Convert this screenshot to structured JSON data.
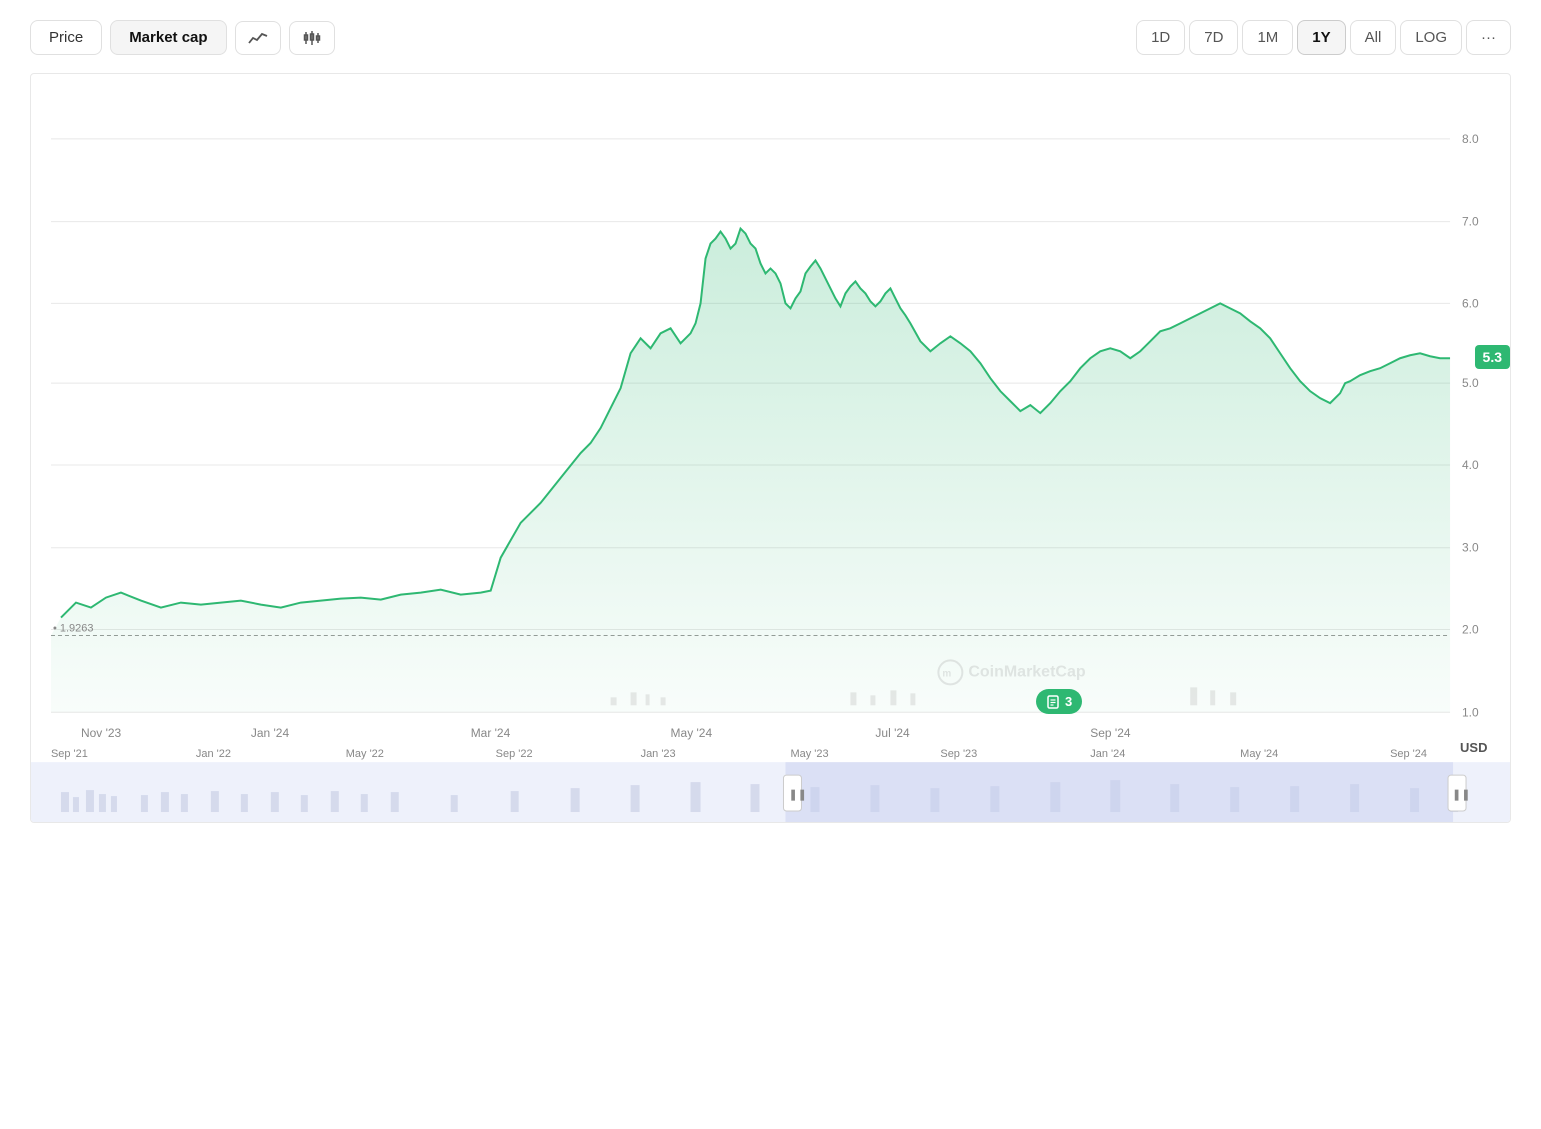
{
  "toolbar": {
    "left": {
      "price_label": "Price",
      "market_cap_label": "Market cap",
      "line_icon": "〜",
      "candle_icon": "⊞"
    },
    "right": {
      "time_buttons": [
        "1D",
        "7D",
        "1M",
        "1Y",
        "All",
        "LOG",
        "..."
      ],
      "active": "1Y"
    }
  },
  "chart": {
    "current_value": "5.3",
    "start_value": "1.9263",
    "y_axis": [
      "8.0",
      "7.0",
      "6.0",
      "5.0",
      "4.0",
      "3.0",
      "2.0",
      "1.0"
    ],
    "x_axis_main": [
      "Nov '23",
      "Jan '24",
      "Mar '24",
      "May '24",
      "Jul '24",
      "Sep '24"
    ],
    "x_axis_mini": [
      "Sep '21",
      "Jan '22",
      "May '22",
      "Sep '22",
      "Jan '23",
      "May '23",
      "Sep '23",
      "Jan '24",
      "May '24",
      "Sep '24"
    ],
    "usd_label": "USD",
    "watermark": "CoinMarketCap",
    "event_badge": "3"
  }
}
